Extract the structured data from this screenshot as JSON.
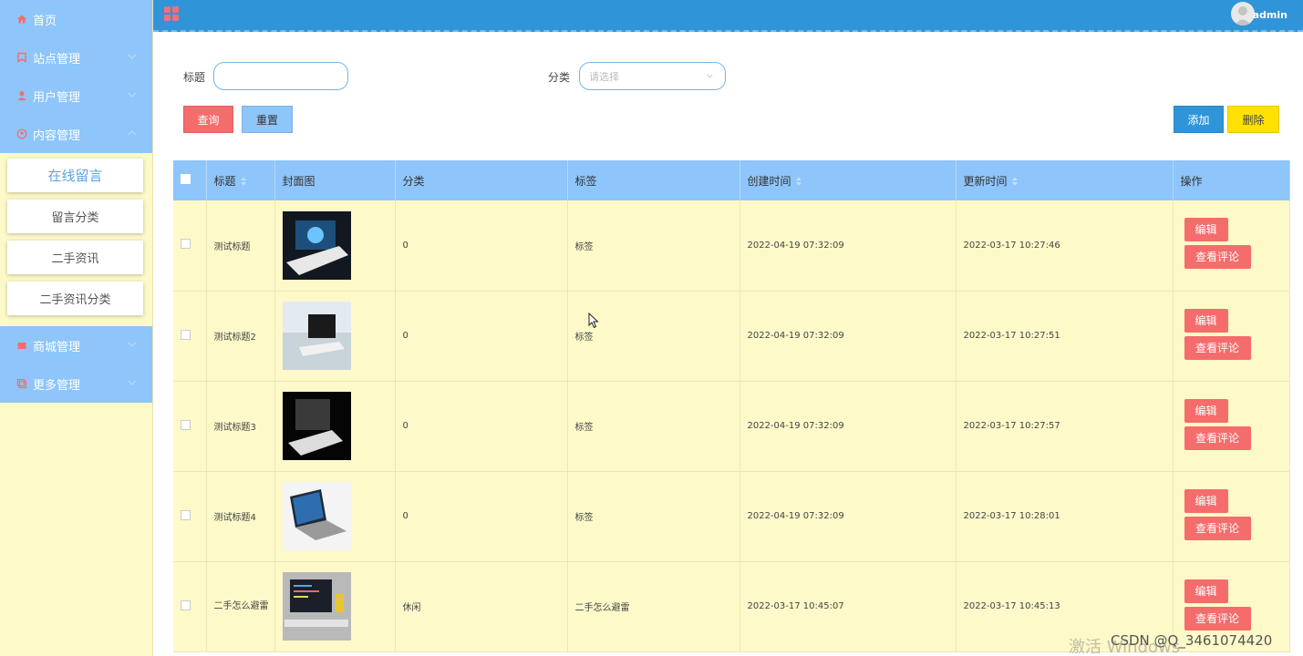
{
  "sidebar": {
    "items": [
      {
        "label": "首页"
      },
      {
        "label": "站点管理"
      },
      {
        "label": "用户管理"
      },
      {
        "label": "内容管理"
      },
      {
        "label": "商城管理"
      },
      {
        "label": "更多管理"
      }
    ],
    "content_submenu": [
      {
        "label": "在线留言"
      },
      {
        "label": "留言分类"
      },
      {
        "label": "二手资讯"
      },
      {
        "label": "二手资讯分类"
      }
    ]
  },
  "header": {
    "username": "admin"
  },
  "search": {
    "title_label": "标题",
    "title_value": "",
    "category_label": "分类",
    "category_placeholder": "请选择",
    "query_button": "查询",
    "reset_button": "重置",
    "add_button": "添加",
    "delete_button": "删除"
  },
  "table": {
    "headers": {
      "title": "标题",
      "cover": "封面图",
      "category": "分类",
      "tag": "标签",
      "created": "创建时间",
      "updated": "更新时间",
      "actions": "操作"
    },
    "rows": [
      {
        "title": "测试标题",
        "category": "0",
        "tag": "标签",
        "created": "2022-04-19 07:32:09",
        "updated": "2022-03-17 10:27:46"
      },
      {
        "title": "测试标题2",
        "category": "0",
        "tag": "标签",
        "created": "2022-04-19 07:32:09",
        "updated": "2022-03-17 10:27:51"
      },
      {
        "title": "测试标题3",
        "category": "0",
        "tag": "标签",
        "created": "2022-04-19 07:32:09",
        "updated": "2022-03-17 10:27:57"
      },
      {
        "title": "测试标题4",
        "category": "0",
        "tag": "标签",
        "created": "2022-04-19 07:32:09",
        "updated": "2022-03-17 10:28:01"
      },
      {
        "title": "二手怎么避雷",
        "category": "休闲",
        "tag": "二手怎么避雷",
        "created": "2022-03-17 10:45:07",
        "updated": "2022-03-17 10:45:13"
      }
    ],
    "edit_button": "编辑",
    "view_comments_button": "查看评论"
  },
  "overlay": {
    "activate_windows": "激活 Windows",
    "csdn_watermark": "CSDN @Q_3461074420"
  },
  "colors": {
    "sidebar_menu": "#8ec5fa",
    "sidebar_bg": "#fdf9c9",
    "header": "#2f95d8",
    "danger": "#f56c6c",
    "warning": "#ffe200",
    "table_row": "#fdf9c9"
  }
}
